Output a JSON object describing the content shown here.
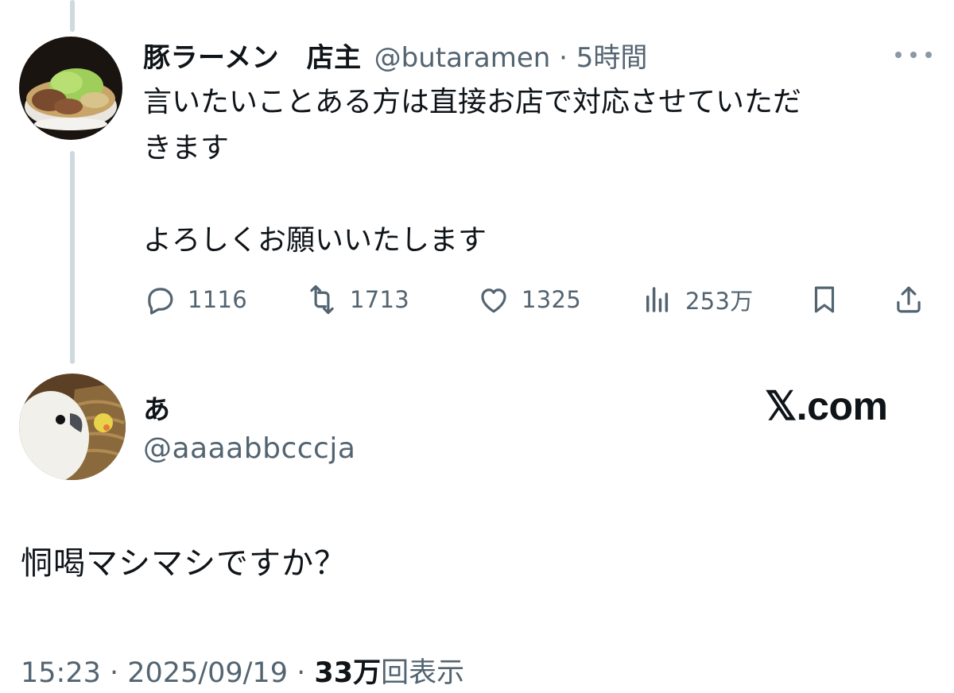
{
  "parent_tweet": {
    "display_name": "豚ラーメン　店主",
    "handle_time": "@butaramen · 5時間",
    "text": "言いたいことある方は直接お店で対応させていただ\nきます\n\nよろしくお願いいたします",
    "actions": {
      "replies": "1116",
      "retweets": "1713",
      "likes": "1325",
      "views": "253万"
    }
  },
  "reply_tweet": {
    "display_name": "あ",
    "handle": "@aaaabbcccja",
    "watermark": "𝕏.com",
    "text": "恫喝マシマシですか？",
    "meta_time": "15:23 · 2025/09/19 · ",
    "views_count": "33万",
    "views_label": "回表示"
  },
  "icons": {
    "more": "more-dots-icon",
    "reply": "reply-bubble-icon",
    "retweet": "retweet-icon",
    "like": "heart-icon",
    "views": "analytics-bars-icon",
    "bookmark": "bookmark-icon",
    "share": "share-icon"
  },
  "colors": {
    "text": "#0f1419",
    "muted": "#536471",
    "thread_line": "#cfd9de"
  }
}
